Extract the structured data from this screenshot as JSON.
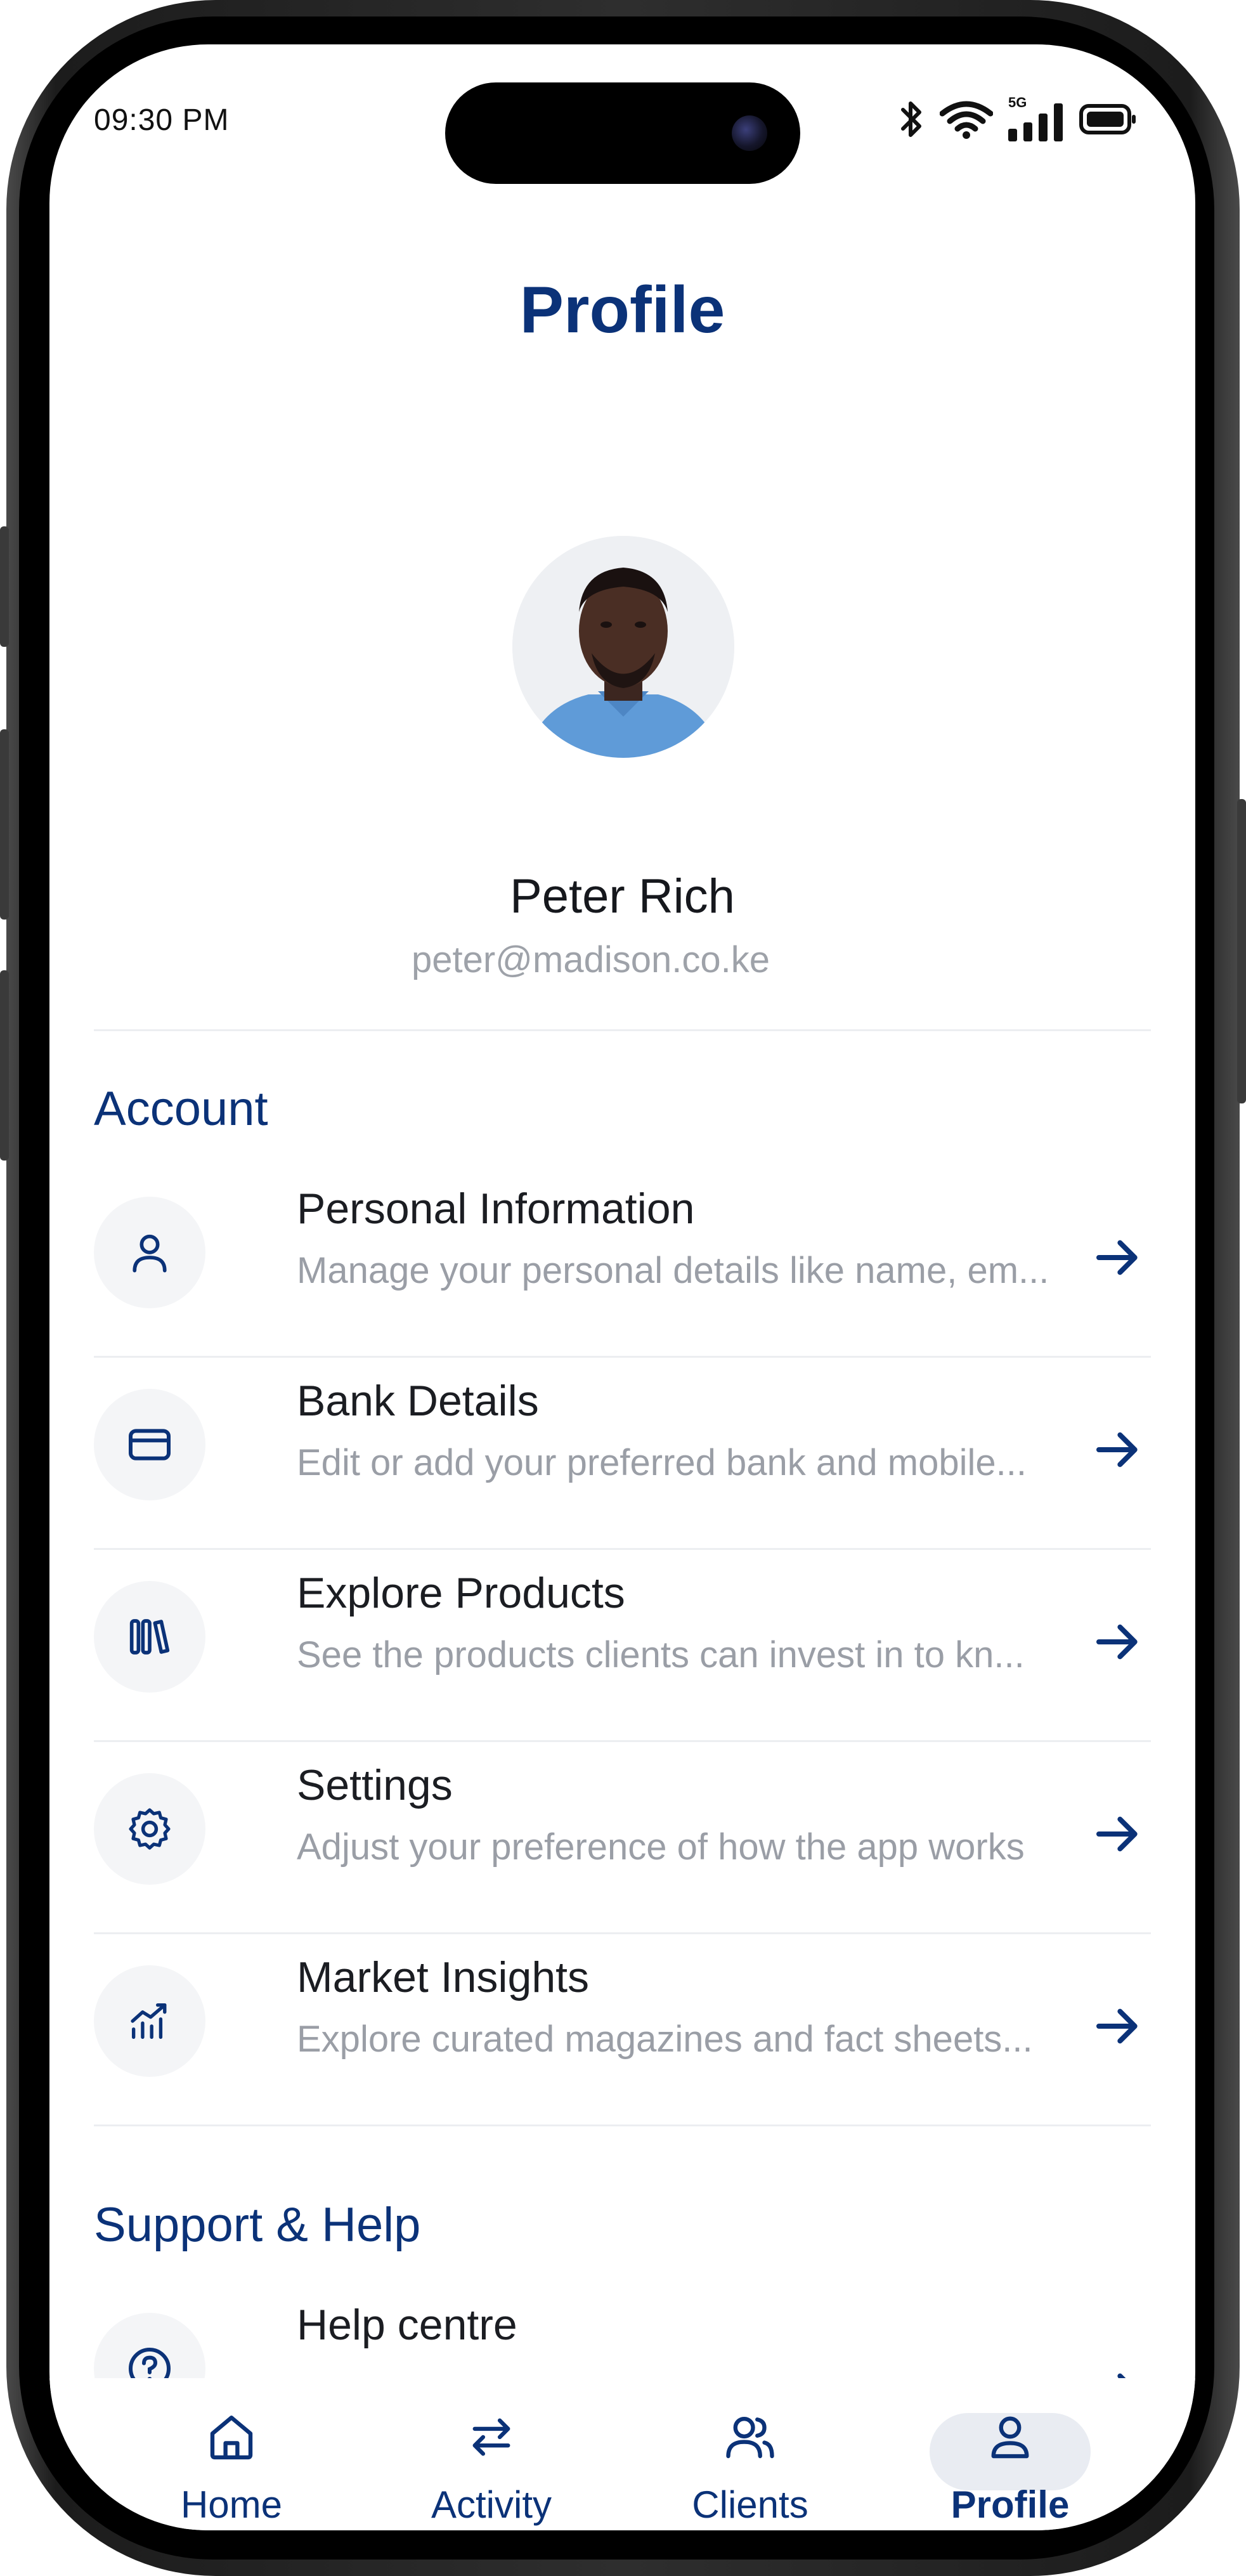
{
  "status_bar": {
    "time": "09:30 PM",
    "network": "5G"
  },
  "header": {
    "title": "Profile"
  },
  "profile": {
    "name": "Peter Rich",
    "email": "peter@madison.co.ke"
  },
  "account": {
    "title": "Account",
    "items": [
      {
        "title": "Personal Information",
        "subtitle": "Manage your personal details like name, em...",
        "icon": "user-icon"
      },
      {
        "title": "Bank Details",
        "subtitle": "Edit or add your preferred bank and mobile...",
        "icon": "card-icon"
      },
      {
        "title": "Explore Products",
        "subtitle": "See the products clients can invest in to kn...",
        "icon": "books-icon"
      },
      {
        "title": "Settings",
        "subtitle": "Adjust your preference of how the app works",
        "icon": "gear-icon"
      },
      {
        "title": "Market Insights",
        "subtitle": "Explore curated magazines and fact sheets...",
        "icon": "chart-icon"
      }
    ]
  },
  "support": {
    "title": "Support & Help",
    "items": [
      {
        "title": "Help centre",
        "icon": "help-icon"
      }
    ]
  },
  "nav": {
    "items": [
      {
        "label": "Home",
        "icon": "home-icon"
      },
      {
        "label": "Activity",
        "icon": "swap-icon"
      },
      {
        "label": "Clients",
        "icon": "users-icon"
      },
      {
        "label": "Profile",
        "icon": "profile-icon",
        "active": true
      }
    ]
  },
  "colors": {
    "brand": "#0b3278",
    "muted": "#9a9ea6",
    "divider": "#eceef1"
  }
}
